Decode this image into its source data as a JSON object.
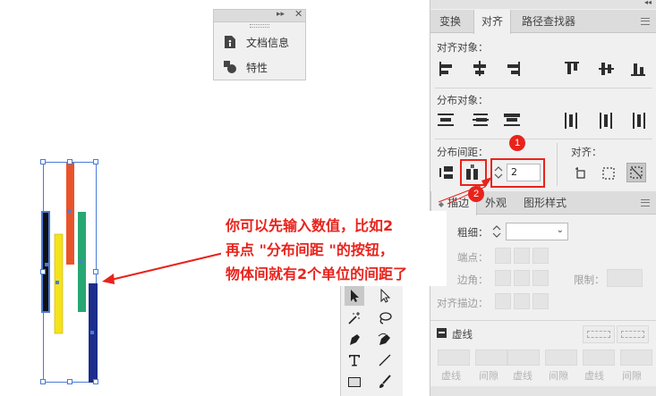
{
  "doc_panel": {
    "items": [
      {
        "label": "文档信息",
        "icon": "document-info-icon"
      },
      {
        "label": "特性",
        "icon": "attributes-icon"
      }
    ]
  },
  "align_panel": {
    "tabs": [
      "变换",
      "对齐",
      "路径查找器"
    ],
    "active_tab": "对齐",
    "align_objects_label": "对齐对象：",
    "distribute_objects_label": "分布对象：",
    "distribute_spacing_label": "分布间距：",
    "align_to_label": "对齐：",
    "spacing_value": "2"
  },
  "stroke_panel": {
    "tabs": [
      "描边",
      "外观",
      "图形样式"
    ],
    "active_tab": "描边",
    "weight_label": "粗细：",
    "cap_label": "端点：",
    "corner_label": "边角：",
    "limit_label": "限制：",
    "align_stroke_label": "对齐描边：",
    "dashed_label": "虚线",
    "dash_labels": [
      "虚线",
      "间隙",
      "虚线",
      "间隙",
      "虚线",
      "间隙"
    ]
  },
  "annotation": {
    "lines": [
      "你可以先输入数值，比如2",
      "再点 \"分布间距 \"的按钮，",
      "物体间就有2个单位的间距了"
    ],
    "badge1": "1",
    "badge2": "2"
  },
  "colors": {
    "annotation_red": "#e8231c",
    "selection_blue": "#4a7bd8",
    "bar_black": "#111111",
    "bar_yellow": "#f5e31a",
    "bar_orange": "#e8542a",
    "bar_green": "#27a772",
    "bar_navy": "#1c2d8c"
  }
}
